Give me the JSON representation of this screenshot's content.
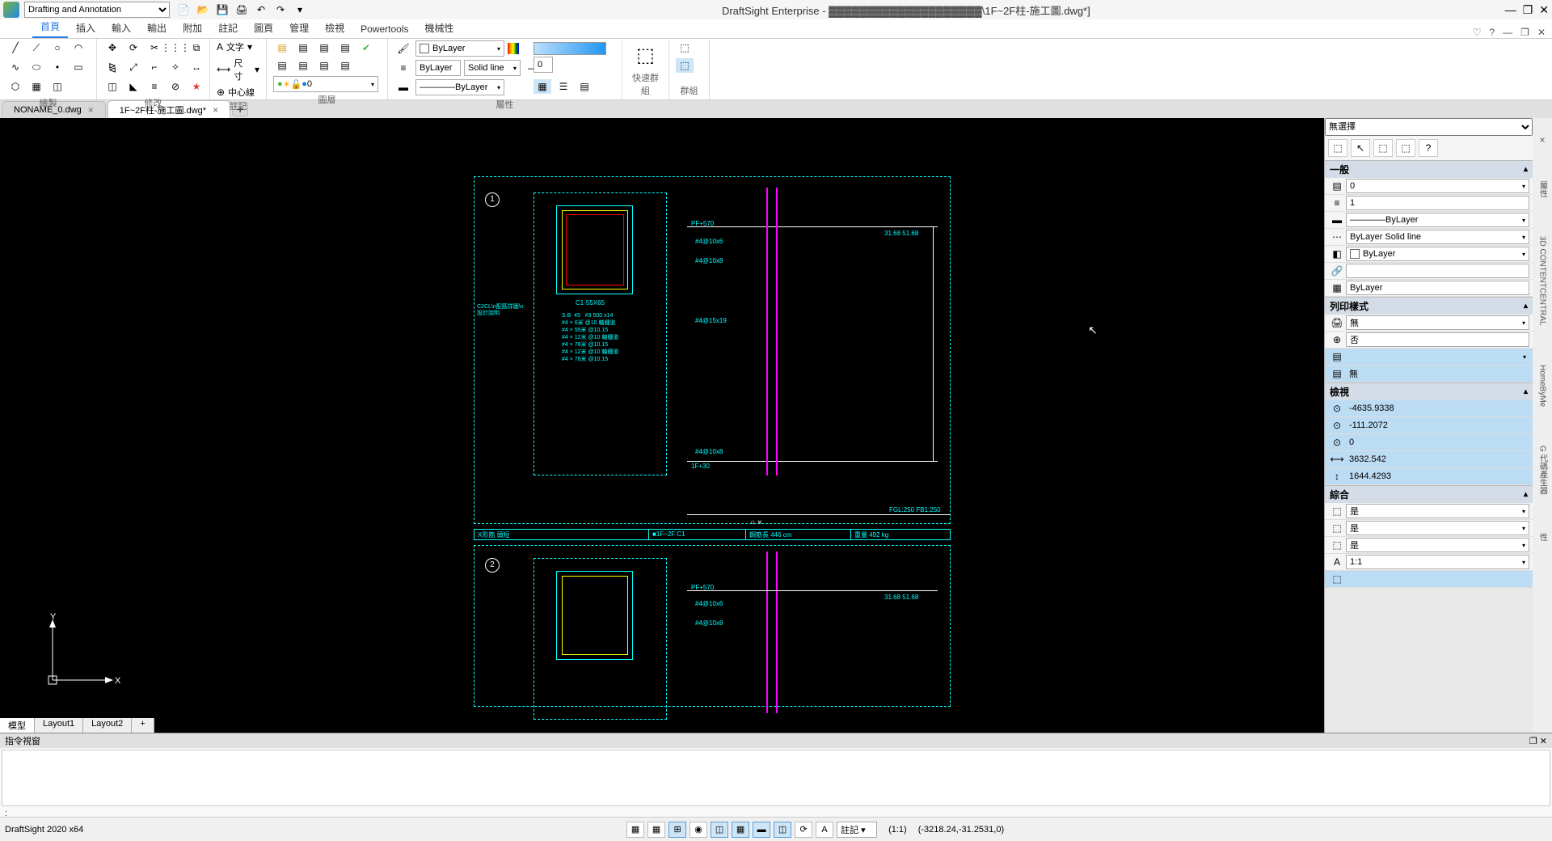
{
  "title": "DraftSight Enterprise - ▓▓▓▓▓▓▓▓▓▓▓▓▓▓▓▓▓▓▓▓\\1F~2F柱-施工圖.dwg*]",
  "workspace": "Drafting and Annotation",
  "menu": {
    "tabs": [
      "首頁",
      "插入",
      "輸入",
      "輸出",
      "附加",
      "註記",
      "圖頁",
      "管理",
      "檢視",
      "Powertools",
      "機械性"
    ],
    "active": 0
  },
  "ribbon": {
    "panels": {
      "draw": "繪製",
      "modify": "修改",
      "annotate": "註記",
      "layer": "圖層",
      "properties": "屬性",
      "quickgroup": "快速群組",
      "group": "群組"
    },
    "annotate": {
      "text": "文字",
      "dim": "尺寸",
      "center": "中心線"
    },
    "layer": {
      "value": "0"
    },
    "props": {
      "color": "ByLayer",
      "line": "Solid line",
      "weight": "ByLayer",
      "styleprefix": "ByLayer"
    },
    "transparency": "0"
  },
  "file_tabs": [
    {
      "name": "NONAME_0.dwg",
      "active": false
    },
    {
      "name": "1F~2F柱-施工圖.dwg*",
      "active": true
    }
  ],
  "layout_tabs": [
    "模型",
    "Layout1",
    "Layout2"
  ],
  "props": {
    "header": "無選擇",
    "sections": {
      "general": "一般",
      "print": "列印樣式",
      "view": "檢視",
      "misc": "綜合"
    },
    "general": {
      "layer": "0",
      "scale": "1",
      "color": "ByLayer",
      "line": "ByLayer   Solid line",
      "weight": "ByLayer",
      "hyperlink": "",
      "transparency": "ByLayer"
    },
    "print": {
      "style": "無",
      "plot": "否",
      "table": "",
      "attached": "無"
    },
    "view": {
      "x": "-4635.9338",
      "y": "-111.2072",
      "z": "0",
      "w": "3632.542",
      "h": "1644.4293"
    },
    "misc": {
      "a": "是",
      "b": "是",
      "c": "是",
      "scale": "1:1",
      "ann": ""
    }
  },
  "drawing": {
    "labels": {
      "section_id": "C1-55X65",
      "rebar1": "#4@10x6",
      "rebar2": "#4@10x8",
      "rebar3": "#4@15x19",
      "rebar4": "#4@10x8",
      "level_top": "PF+570",
      "level_bot": "1F+30",
      "fgl": "FGL:250   FB1:250",
      "notes": "S.B  45   #3 500 x14\n#4 × 6米 @10 軸鍾道\n#4 × 55米 @10.15\n#4 × 12米 @10 軸鍾道\n#4 × 78米 @10.15\n#4 × 12米 @10 軸鍾道\n#4 × 78米 @10.15",
      "row_title": "X形筋 頭短",
      "row_floor": "■1F~2F C1",
      "row_len": "鋼筋長 446 cm",
      "row_wt": "重量 492 kg",
      "dim1": "31.68  51.68"
    }
  },
  "side_tabs": [
    "屬性",
    "3D CONTENTCENTRAL",
    "HomeByMe",
    "G 代碼產生器",
    "性"
  ],
  "cmd": {
    "title": "指令視窗",
    "prompt": ":"
  },
  "status": {
    "left": "DraftSight 2020 x64",
    "anno": "註記 ▾",
    "ratio": "(1:1)",
    "coords": "(-3218.24,-31.2531,0)"
  }
}
